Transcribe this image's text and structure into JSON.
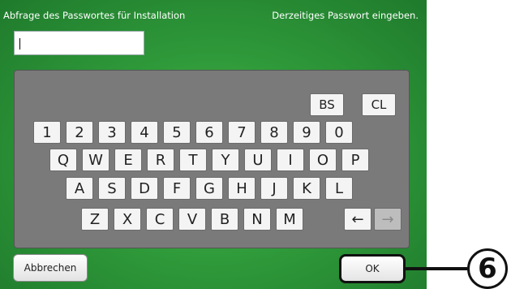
{
  "header": {
    "title": "Abfrage des Passwortes für Installation",
    "prompt": "Derzeitiges Passwort eingeben."
  },
  "password_field": {
    "value": ""
  },
  "keyboard": {
    "bs_label": "BS",
    "cl_label": "CL",
    "row1": [
      "1",
      "2",
      "3",
      "4",
      "5",
      "6",
      "7",
      "8",
      "9",
      "0"
    ],
    "row2": [
      "Q",
      "W",
      "E",
      "R",
      "T",
      "Y",
      "U",
      "I",
      "O",
      "P"
    ],
    "row3": [
      "A",
      "S",
      "D",
      "F",
      "G",
      "H",
      "J",
      "K",
      "L"
    ],
    "row4": [
      "Z",
      "X",
      "C",
      "V",
      "B",
      "N",
      "M"
    ],
    "left_arrow": "←",
    "right_arrow": "→"
  },
  "buttons": {
    "cancel": "Abbrechen",
    "ok": "OK"
  },
  "callout": {
    "label": "6"
  }
}
